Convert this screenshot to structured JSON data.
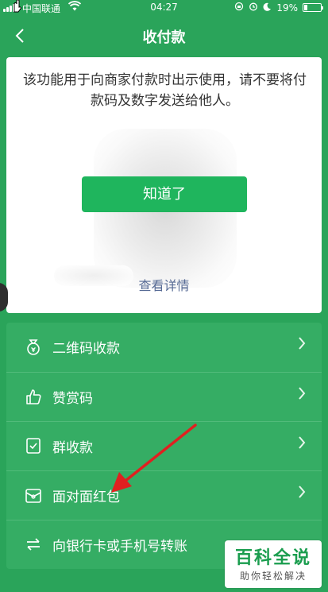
{
  "status_bar": {
    "carrier": "中国联通",
    "time": "04:27",
    "battery": "19%",
    "battery_level": 0.19
  },
  "nav": {
    "title": "收付款",
    "back_icon": "chevron-left-icon"
  },
  "card": {
    "notice": "该功能用于向商家付款时出示使用，请不要将付款码及数字发送给他人。",
    "ok_label": "知道了",
    "detail_label": "查看详情"
  },
  "menu": {
    "items": [
      {
        "label": "二维码收款",
        "icon": "money-bag-icon"
      },
      {
        "label": "赞赏码",
        "icon": "thumbs-up-icon"
      },
      {
        "label": "群收款",
        "icon": "group-collect-icon"
      },
      {
        "label": "面对面红包",
        "icon": "red-packet-icon"
      },
      {
        "label": "向银行卡或手机号转账",
        "icon": "transfer-arrows-icon"
      }
    ]
  },
  "watermark": {
    "title": "百科全说",
    "subtitle": "助你轻松解决"
  },
  "colors": {
    "background": "#2aa45a",
    "button": "#1fb55d",
    "link": "#576b95",
    "arrow": "#e02020"
  }
}
